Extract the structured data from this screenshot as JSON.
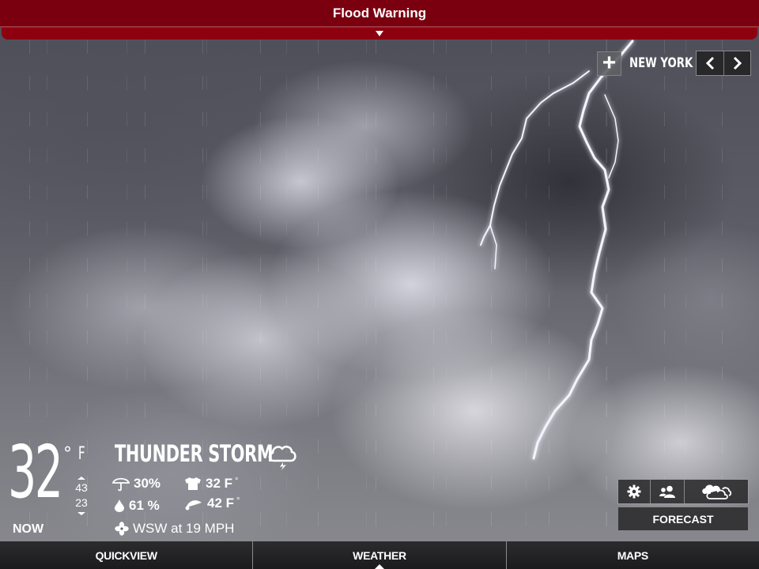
{
  "alert": {
    "title": "Flood Warning",
    "expand_icon": "triangle-down-icon",
    "color": "#7a000f"
  },
  "location": {
    "add_icon": "plus-icon",
    "add_symbol": "+",
    "city": "NEW YORK",
    "prev_icon": "chevron-left-icon",
    "next_icon": "chevron-right-icon"
  },
  "current": {
    "temperature": "32",
    "degree_symbol": "°",
    "unit": "F",
    "now_label": "NOW",
    "high": "43",
    "low": "23",
    "condition": "THUNDER STORM",
    "condition_icon": "cloud-lightning-icon",
    "precip_chance": "30%",
    "humidity": "61 %",
    "feels_like": "32 F",
    "dew_point": "42 F",
    "degree_small": "°",
    "wind": "WSW at 19 MPH"
  },
  "controls": {
    "settings_icon": "gear-icon",
    "people_icon": "people-icon",
    "clouds_icon": "clouds-icon",
    "forecast_label": "FORECAST"
  },
  "tabs": [
    {
      "label": "QUICKVIEW",
      "active": false
    },
    {
      "label": "WEATHER",
      "active": true
    },
    {
      "label": "MAPS",
      "active": false
    }
  ]
}
